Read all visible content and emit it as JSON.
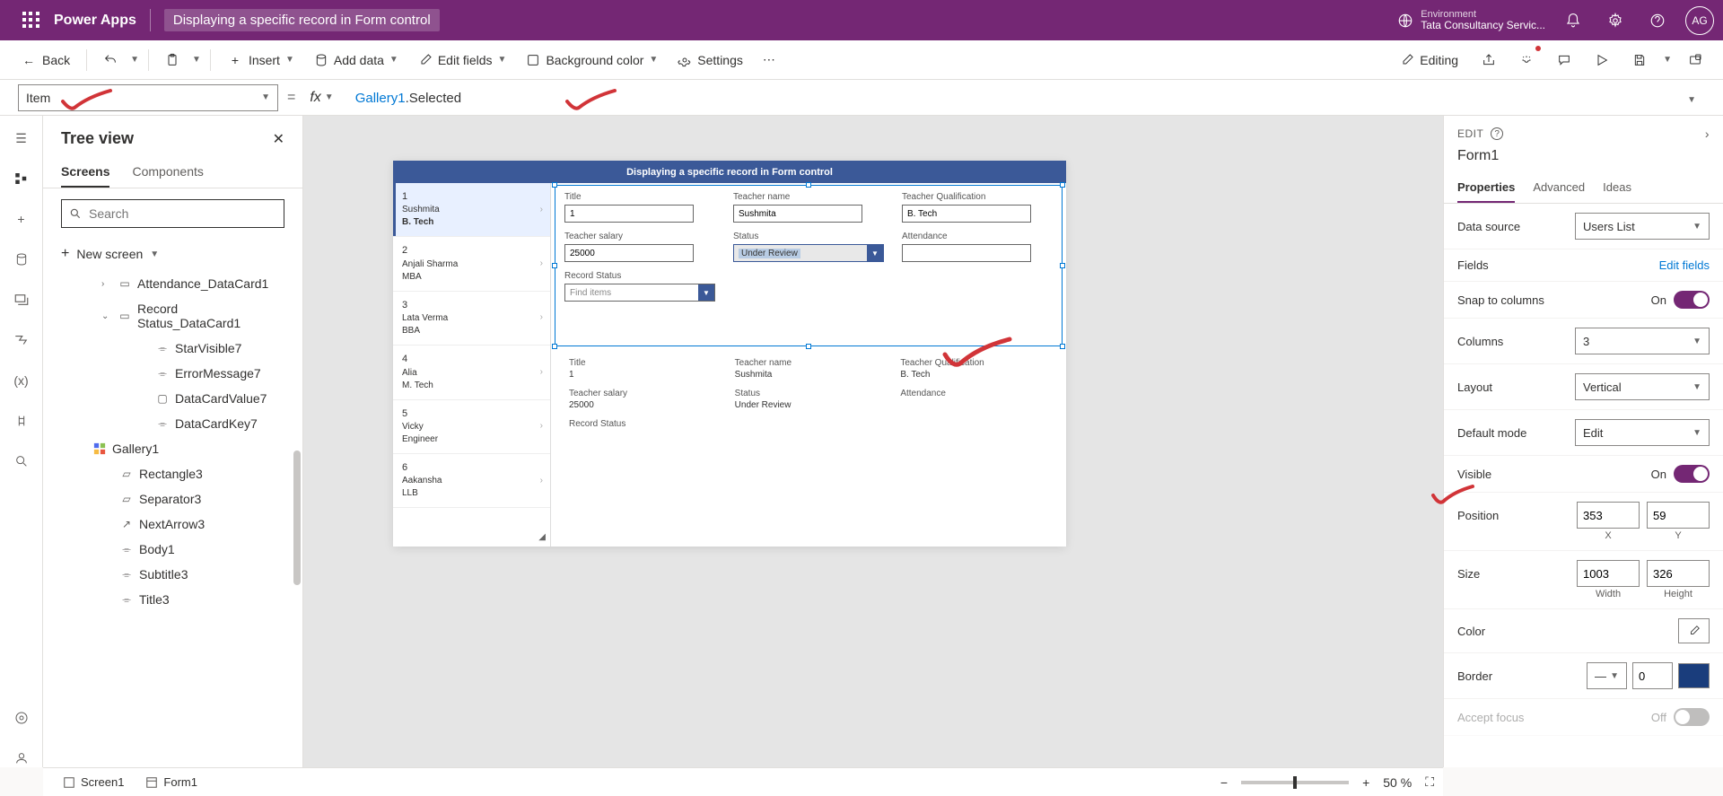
{
  "header": {
    "app": "Power Apps",
    "doc": "Displaying a specific record in Form control",
    "env_label": "Environment",
    "env_name": "Tata Consultancy Servic...",
    "avatar": "AG"
  },
  "cmd": {
    "back": "Back",
    "insert": "Insert",
    "add_data": "Add data",
    "edit_fields": "Edit fields",
    "bg_color": "Background color",
    "settings": "Settings",
    "editing": "Editing"
  },
  "formula": {
    "property": "Item",
    "object": "Gallery1",
    "member": ".Selected"
  },
  "tree": {
    "title": "Tree view",
    "tab_screens": "Screens",
    "tab_components": "Components",
    "search_ph": "Search",
    "new_screen": "New screen",
    "items": [
      {
        "label": "Attendance_DataCard1",
        "level": 1,
        "icon": "card",
        "chev": ">"
      },
      {
        "label": "Record Status_DataCard1",
        "level": 1,
        "icon": "card",
        "chev": "v"
      },
      {
        "label": "StarVisible7",
        "level": 3,
        "icon": "label"
      },
      {
        "label": "ErrorMessage7",
        "level": 3,
        "icon": "label"
      },
      {
        "label": "DataCardValue7",
        "level": 3,
        "icon": "input"
      },
      {
        "label": "DataCardKey7",
        "level": 3,
        "icon": "label"
      },
      {
        "label": "Gallery1",
        "level": 1,
        "icon": "gallery",
        "chev": ""
      },
      {
        "label": "Rectangle3",
        "level": 2,
        "icon": "rect"
      },
      {
        "label": "Separator3",
        "level": 2,
        "icon": "rect"
      },
      {
        "label": "NextArrow3",
        "level": 2,
        "icon": "arrow"
      },
      {
        "label": "Body1",
        "level": 2,
        "icon": "label"
      },
      {
        "label": "Subtitle3",
        "level": 2,
        "icon": "label"
      },
      {
        "label": "Title3",
        "level": 2,
        "icon": "label"
      }
    ]
  },
  "canvas": {
    "title": "Displaying a specific record in Form control",
    "gallery": [
      {
        "n": "1",
        "name": "Sushmita",
        "deg": "B. Tech",
        "sel": true
      },
      {
        "n": "2",
        "name": "Anjali Sharma",
        "deg": "MBA"
      },
      {
        "n": "3",
        "name": "Lata Verma",
        "deg": "BBA"
      },
      {
        "n": "4",
        "name": "Alia",
        "deg": "M. Tech"
      },
      {
        "n": "5",
        "name": "Vicky",
        "deg": "Engineer"
      },
      {
        "n": "6",
        "name": "Aakansha",
        "deg": "LLB"
      }
    ],
    "form": {
      "title_lbl": "Title",
      "title_val": "1",
      "tname_lbl": "Teacher name",
      "tname_val": "Sushmita",
      "qual_lbl": "Teacher Qualification",
      "qual_val": "B. Tech",
      "sal_lbl": "Teacher salary",
      "sal_val": "25000",
      "status_lbl": "Status",
      "status_val": "Under Review",
      "att_lbl": "Attendance",
      "att_val": "",
      "rec_lbl": "Record Status",
      "rec_ph": "Find items"
    },
    "read": {
      "title_lbl": "Title",
      "title_val": "1",
      "tname_lbl": "Teacher name",
      "tname_val": "Sushmita",
      "qual_lbl": "Teacher Qualification",
      "qual_val": "B. Tech",
      "sal_lbl": "Teacher salary",
      "sal_val": "25000",
      "status_lbl": "Status",
      "status_val": "Under Review",
      "att_lbl": "Attendance",
      "rec_lbl": "Record Status"
    }
  },
  "props": {
    "edit": "EDIT",
    "name": "Form1",
    "tab_p": "Properties",
    "tab_a": "Advanced",
    "tab_i": "Ideas",
    "ds_lbl": "Data source",
    "ds_val": "Users List",
    "fields_lbl": "Fields",
    "fields_link": "Edit fields",
    "snap_lbl": "Snap to columns",
    "on": "On",
    "off": "Off",
    "cols_lbl": "Columns",
    "cols_val": "3",
    "layout_lbl": "Layout",
    "layout_val": "Vertical",
    "mode_lbl": "Default mode",
    "mode_val": "Edit",
    "vis_lbl": "Visible",
    "pos_lbl": "Position",
    "pos_x": "353",
    "pos_y": "59",
    "x": "X",
    "y": "Y",
    "size_lbl": "Size",
    "size_w": "1003",
    "size_h": "326",
    "w": "Width",
    "h": "Height",
    "color_lbl": "Color",
    "border_lbl": "Border",
    "border_val": "0"
  },
  "status": {
    "screen1": "Screen1",
    "form1": "Form1",
    "zoom": "50",
    "pct": "%"
  }
}
